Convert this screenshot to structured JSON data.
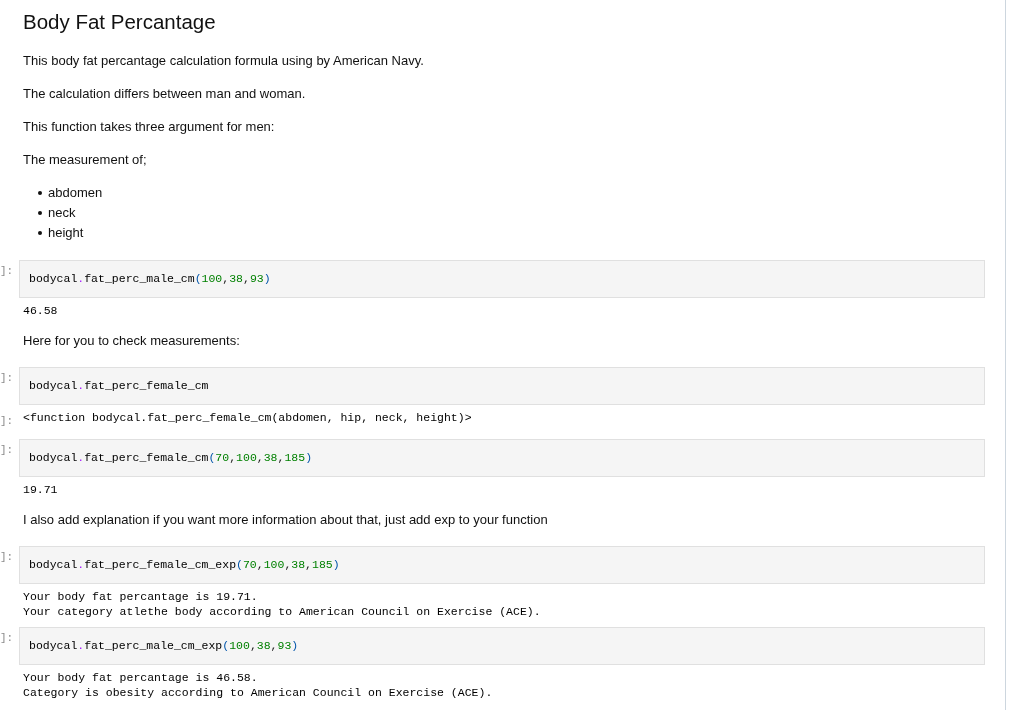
{
  "notebook": {
    "cells": [
      {
        "kind": "markdown",
        "blocks": [
          {
            "kind": "heading",
            "text": "Body Fat Percantage"
          },
          {
            "kind": "paragraph",
            "text": "This body fat percantage calculation formula using by American Navy."
          },
          {
            "kind": "paragraph",
            "text": "The calculation differs between man and woman."
          },
          {
            "kind": "paragraph",
            "text": "This function takes three argument for men:"
          },
          {
            "kind": "paragraph",
            "text": "The measurement of;"
          },
          {
            "kind": "list",
            "items": [
              "abdomen",
              "neck",
              "height"
            ]
          }
        ]
      },
      {
        "kind": "code",
        "prompt": "]:",
        "tokens": [
          {
            "kind": "name",
            "text": "bodycal"
          },
          {
            "kind": "operator",
            "text": "."
          },
          {
            "kind": "name",
            "text": "fat_perc_male_cm"
          },
          {
            "kind": "bracket",
            "text": "("
          },
          {
            "kind": "number",
            "text": "100"
          },
          {
            "kind": "punct",
            "text": ","
          },
          {
            "kind": "number",
            "text": "38"
          },
          {
            "kind": "punct",
            "text": ","
          },
          {
            "kind": "number",
            "text": "93"
          },
          {
            "kind": "bracket",
            "text": ")"
          }
        ],
        "output": {
          "lines": [
            "46.58"
          ]
        }
      },
      {
        "kind": "markdown",
        "blocks": [
          {
            "kind": "paragraph",
            "text": "Here for you to check measurements:"
          }
        ]
      },
      {
        "kind": "code",
        "prompt": "]:",
        "tokens": [
          {
            "kind": "name",
            "text": "bodycal"
          },
          {
            "kind": "operator",
            "text": "."
          },
          {
            "kind": "name",
            "text": "fat_perc_female_cm"
          }
        ],
        "output": {
          "prompt": "]:",
          "lines": [
            "<function bodycal.fat_perc_female_cm(abdomen, hip, neck, height)>"
          ]
        }
      },
      {
        "kind": "code",
        "prompt": "]:",
        "tokens": [
          {
            "kind": "name",
            "text": "bodycal"
          },
          {
            "kind": "operator",
            "text": "."
          },
          {
            "kind": "name",
            "text": "fat_perc_female_cm"
          },
          {
            "kind": "bracket",
            "text": "("
          },
          {
            "kind": "number",
            "text": "70"
          },
          {
            "kind": "punct",
            "text": ","
          },
          {
            "kind": "number",
            "text": "100"
          },
          {
            "kind": "punct",
            "text": ","
          },
          {
            "kind": "number",
            "text": "38"
          },
          {
            "kind": "punct",
            "text": ","
          },
          {
            "kind": "number",
            "text": "185"
          },
          {
            "kind": "bracket",
            "text": ")"
          }
        ],
        "output": {
          "lines": [
            "19.71"
          ]
        }
      },
      {
        "kind": "markdown",
        "blocks": [
          {
            "kind": "paragraph",
            "text": "I also add explanation if you want more information about that, just add exp to your function"
          }
        ]
      },
      {
        "kind": "code",
        "prompt": "]:",
        "tokens": [
          {
            "kind": "name",
            "text": "bodycal"
          },
          {
            "kind": "operator",
            "text": "."
          },
          {
            "kind": "name",
            "text": "fat_perc_female_cm_exp"
          },
          {
            "kind": "bracket",
            "text": "("
          },
          {
            "kind": "number",
            "text": "70"
          },
          {
            "kind": "punct",
            "text": ","
          },
          {
            "kind": "number",
            "text": "100"
          },
          {
            "kind": "punct",
            "text": ","
          },
          {
            "kind": "number",
            "text": "38"
          },
          {
            "kind": "punct",
            "text": ","
          },
          {
            "kind": "number",
            "text": "185"
          },
          {
            "kind": "bracket",
            "text": ")"
          }
        ],
        "output": {
          "lines": [
            "Your body fat percantage is 19.71.",
            "Your category atlethe body according to American Council on Exercise (ACE)."
          ]
        }
      },
      {
        "kind": "code",
        "prompt": "]:",
        "tokens": [
          {
            "kind": "name",
            "text": "bodycal"
          },
          {
            "kind": "operator",
            "text": "."
          },
          {
            "kind": "name",
            "text": "fat_perc_male_cm_exp"
          },
          {
            "kind": "bracket",
            "text": "("
          },
          {
            "kind": "number",
            "text": "100"
          },
          {
            "kind": "punct",
            "text": ","
          },
          {
            "kind": "number",
            "text": "38"
          },
          {
            "kind": "punct",
            "text": ","
          },
          {
            "kind": "number",
            "text": "93"
          },
          {
            "kind": "bracket",
            "text": ")"
          }
        ],
        "output": {
          "lines": [
            "Your body fat percantage is 46.58.",
            "Category is obesity according to American Council on Exercise (ACE)."
          ]
        }
      }
    ]
  }
}
